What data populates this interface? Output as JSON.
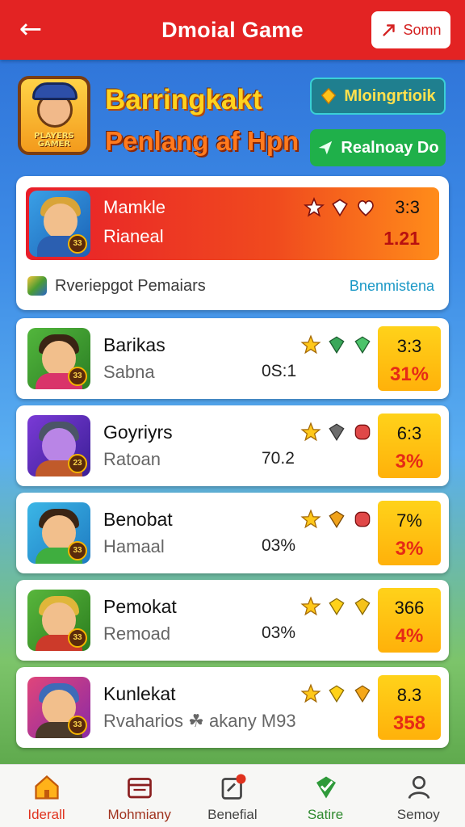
{
  "header": {
    "title": "Dmoial Game",
    "back_icon": "arrow-left-icon",
    "action_label": "Somn",
    "action_icon": "external-link-icon"
  },
  "hero": {
    "title": "Barringkakt",
    "subtitle": "Penlang af Hpn",
    "logo_text": "PLAYERS GAMER",
    "pill1_label": "Mloingrtioik",
    "pill2_label": "Realnoay Do"
  },
  "featured": {
    "name": "Mamkle",
    "sub": "Rianeal",
    "score_top": "3:3",
    "score_bottom": "1.21",
    "badge": "33",
    "footer_text": "Rveriepgot Pemaiars",
    "footer_link": "Bnenmistena"
  },
  "rows": [
    {
      "name": "Barikas",
      "sub": "Sabna",
      "mid": "0S:1",
      "score_top": "3:3",
      "score_bottom": "31%",
      "badge": "33"
    },
    {
      "name": "Goyriyrs",
      "sub": "Ratoan",
      "mid": "70.2",
      "score_top": "6:3",
      "score_bottom": "3%",
      "badge": "23"
    },
    {
      "name": "Benobat",
      "sub": "Hamaal",
      "mid": "03%",
      "score_top": "7%",
      "score_bottom": "3%",
      "badge": "33"
    },
    {
      "name": "Pemokat",
      "sub": "Remoad",
      "mid": "03%",
      "score_top": "366",
      "score_bottom": "4%",
      "badge": "33"
    },
    {
      "name": "Kunlekat",
      "sub": "Rvaharios ☘ akany M93",
      "mid": "",
      "score_top": "8.3",
      "score_bottom": "358",
      "badge": "33"
    }
  ],
  "nav": [
    {
      "label": "Iderall",
      "icon": "home-icon",
      "color": "#e0321e"
    },
    {
      "label": "Mohmiany",
      "icon": "calendar-icon",
      "color": "#a0321e"
    },
    {
      "label": "Benefial",
      "icon": "notes-icon",
      "color": "#444444"
    },
    {
      "label": "Satire",
      "icon": "badge-check-icon",
      "color": "#2f8a2f"
    },
    {
      "label": "Semoy",
      "icon": "user-icon",
      "color": "#444444"
    }
  ],
  "colors": {
    "header_red": "#e32323",
    "score_yellow": "#ffc414",
    "accent_orange": "#ff7a1e"
  }
}
